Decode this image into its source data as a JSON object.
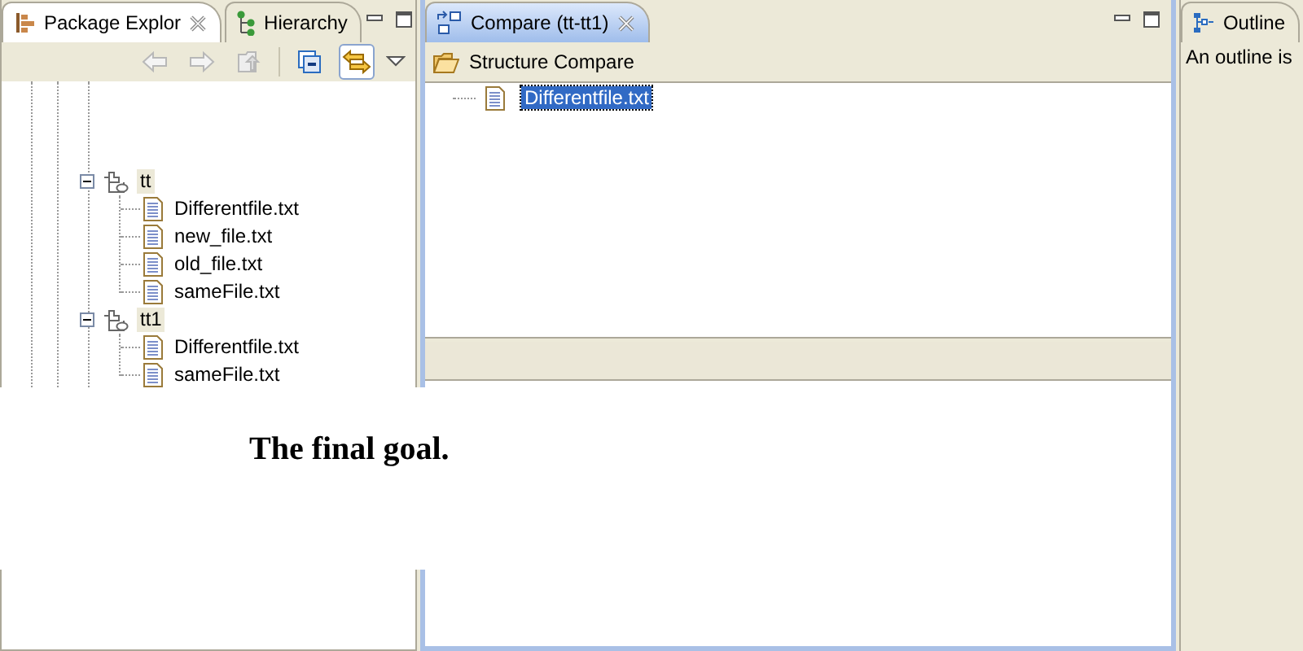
{
  "package_explorer": {
    "tabs": [
      {
        "label": "Package Explor",
        "selected": true
      },
      {
        "label": "Hierarchy",
        "selected": false
      }
    ],
    "toolbar": [
      {
        "kind": "back",
        "disabled": true
      },
      {
        "kind": "forward",
        "disabled": true
      },
      {
        "kind": "up",
        "disabled": true
      },
      {
        "kind": "collapse",
        "disabled": false
      },
      {
        "kind": "link",
        "disabled": false,
        "on": true
      }
    ],
    "tree": [
      {
        "label": "tt",
        "kind": "project",
        "expanded": true,
        "selected": true,
        "children": [
          {
            "label": "Differentfile.txt",
            "kind": "file",
            "selected": false
          },
          {
            "label": "new_file.txt",
            "kind": "file",
            "selected": false
          },
          {
            "label": "old_file.txt",
            "kind": "file",
            "selected": false
          },
          {
            "label": "sameFile.txt",
            "kind": "file",
            "selected": false
          }
        ]
      },
      {
        "label": "tt1",
        "kind": "project",
        "expanded": true,
        "selected": true,
        "children": [
          {
            "label": "Differentfile.txt",
            "kind": "file",
            "selected": false
          },
          {
            "label": "sameFile.txt",
            "kind": "file",
            "selected": false
          }
        ]
      }
    ]
  },
  "compare": {
    "tab": {
      "label": "Compare (tt-tt1)",
      "selected": true
    },
    "header": "Structure Compare",
    "items": [
      {
        "label": "Differentfile.txt",
        "selected": true
      }
    ]
  },
  "outline": {
    "tab": {
      "label": "Outline"
    },
    "message": "An outline is"
  },
  "caption": "The final goal."
}
